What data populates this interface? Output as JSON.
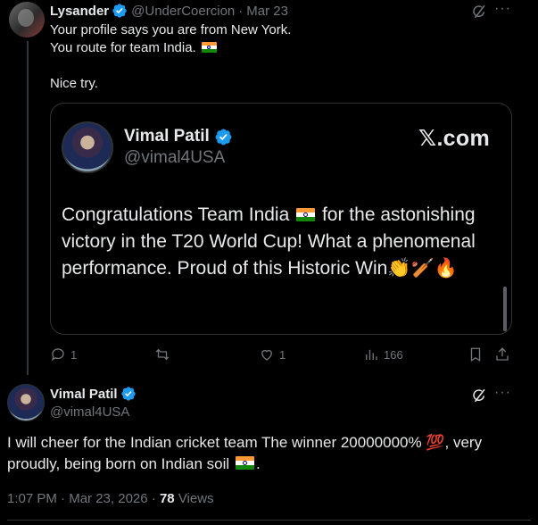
{
  "tweet1": {
    "author": {
      "name": "Lysander",
      "handle": "@UnderCoercion",
      "date": "Mar 23"
    },
    "lines": [
      "Your profile says you are from New York.",
      "You route for team India.",
      "Nice try."
    ],
    "quote": {
      "name": "Vimal Patil",
      "handle": "@vimal4USA",
      "source": "𝕏.com",
      "text_segments": [
        "Congratulations Team India",
        "for the astonishing victory in the T20 World Cup! What a phenomenal performance. Proud of this Historic Win",
        "👏🏏🔥"
      ]
    },
    "actions": {
      "replies": "1",
      "reposts": "",
      "likes": "1",
      "views": "166"
    }
  },
  "tweet2": {
    "author": {
      "name": "Vimal Patil",
      "handle": "@vimal4USA"
    },
    "text_segments": [
      "I will cheer for the Indian cricket team The winner 20000000%",
      "💯",
      ", very proudly, being born on Indian soil",
      "."
    ],
    "meta": {
      "time": "1:07 PM",
      "date": "Mar 23, 2026",
      "views_count": "78",
      "views_label": "Views"
    }
  },
  "icons": {
    "verified": "verified-badge-icon",
    "grok": "grok-icon",
    "more": "more-icon",
    "reply": "reply-icon",
    "repost": "repost-icon",
    "like": "like-icon",
    "views": "views-icon",
    "bookmark": "bookmark-icon",
    "share": "share-icon",
    "flag": "india-flag-icon"
  },
  "colors": {
    "accent": "#1d9bf0",
    "muted": "#71767b",
    "text": "#e7e9ea",
    "background": "#000000"
  }
}
